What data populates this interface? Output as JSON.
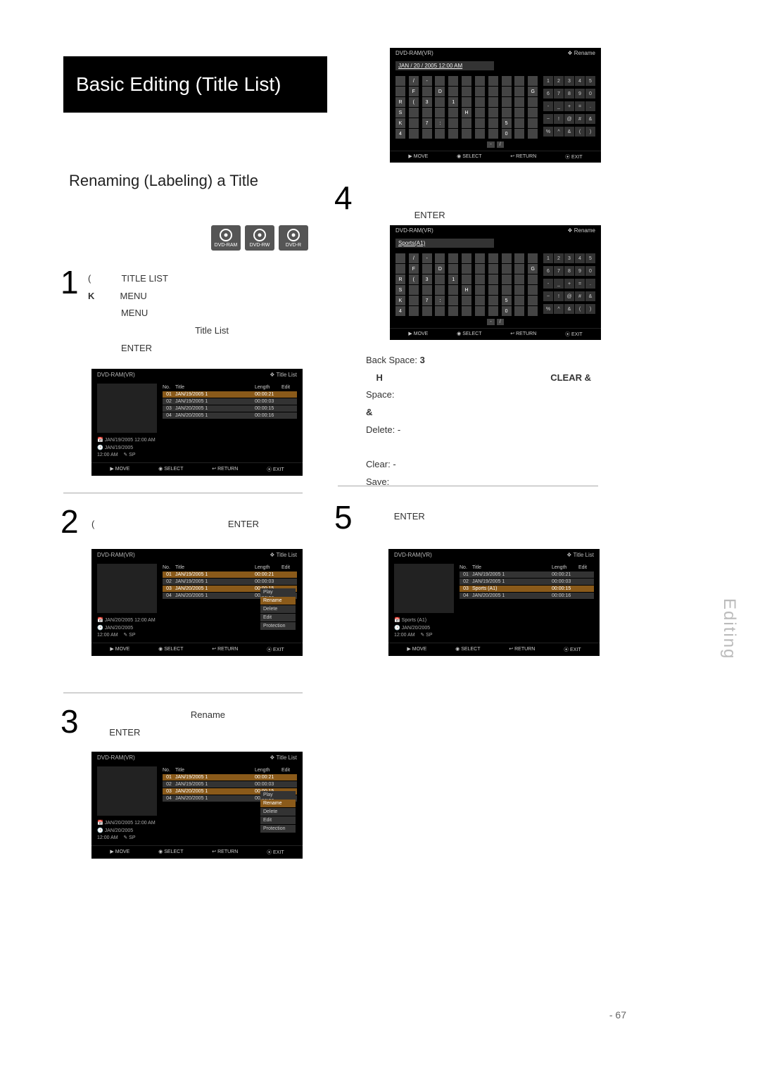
{
  "page": {
    "title": "Basic Editing (Title List)",
    "section": "Renaming (Labeling) a Title",
    "sideTab": "Editing",
    "pageNumber": "- 67"
  },
  "discs": [
    "DVD-RAM",
    "DVD-RW",
    "DVD-R"
  ],
  "steps": {
    "s1": {
      "num": "1",
      "paren": "(",
      "lines": [
        "TITLE LIST",
        "K        MENU",
        "MENU",
        "Title List",
        "ENTER"
      ]
    },
    "s2": {
      "num": "2",
      "paren": "(",
      "enter": "ENTER"
    },
    "s3": {
      "num": "3",
      "rename": "Rename",
      "enter": "ENTER"
    },
    "s4": {
      "num": "4",
      "enter": "ENTER"
    },
    "s5": {
      "num": "5",
      "enter": "ENTER"
    }
  },
  "keyDefs": {
    "backspace": {
      "label": "Back Space:",
      "val": "3"
    },
    "clearTrail": "CLEAR &",
    "h": "H",
    "space": {
      "label": "Space:",
      "val": ""
    },
    "amp": "&",
    "delete": {
      "label": "Delete:",
      "val": "-"
    },
    "clear": {
      "label": "Clear:",
      "val": "-"
    },
    "save": {
      "label": "Save:",
      "val": ""
    }
  },
  "ui": {
    "header_device": "DVD-RAM(VR)",
    "header_mode_title": "❖ Title List",
    "header_mode_rename": "❖ Rename",
    "thead": [
      "No.",
      "Title",
      "Length",
      "Edit"
    ],
    "rows1": [
      {
        "no": "01",
        "title": "JAN/19/2005 1",
        "len": "00:00:21",
        "edit": "",
        "sel": true
      },
      {
        "no": "02",
        "title": "JAN/19/2005 1",
        "len": "00:00:03",
        "edit": ""
      },
      {
        "no": "03",
        "title": "JAN/20/2005 1",
        "len": "00:00:15",
        "edit": ""
      },
      {
        "no": "04",
        "title": "JAN/20/2005 1",
        "len": "00:00:16",
        "edit": ""
      }
    ],
    "rows4": [
      {
        "no": "01",
        "title": "JAN/19/2005 1",
        "len": "00:00:21",
        "edit": ""
      },
      {
        "no": "02",
        "title": "JAN/19/2005 1",
        "len": "00:00:03",
        "edit": ""
      },
      {
        "no": "03",
        "title": "Sports (A1)",
        "len": "00:00:15",
        "edit": "",
        "sel": true
      },
      {
        "no": "04",
        "title": "JAN/20/2005 1",
        "len": "00:00:16",
        "edit": ""
      }
    ],
    "meta1": {
      "l1": "JAN/19/2005 12:00 AM",
      "l2": "JAN/19/2005",
      "l3": "12:00 AM",
      "sp": "✎ SP"
    },
    "meta2": {
      "l1": "JAN/20/2005 12:00 AM",
      "l2": "JAN/20/2005",
      "l3": "12:00 AM",
      "sp": "✎ SP"
    },
    "meta4": {
      "l1": "Sports (A1)",
      "l2": "JAN/20/2005",
      "l3": "12:00 AM",
      "sp": "✎ SP"
    },
    "menu": [
      {
        "label": "Play"
      },
      {
        "label": "Rename",
        "sel": true
      },
      {
        "label": "Delete"
      },
      {
        "label": "Edit"
      },
      {
        "label": "Protection"
      }
    ],
    "footer": [
      "MOVE",
      "SELECT",
      "RETURN",
      "EXIT"
    ]
  },
  "kb": {
    "input1": "JAN   /   20 / 2005   12:00   AM",
    "input2": "Sports(A1)",
    "letters": [
      "",
      "/",
      "-",
      "",
      "",
      "",
      "",
      "",
      "",
      "",
      "",
      "",
      "F",
      "",
      "D",
      "",
      "",
      "",
      "",
      "",
      "",
      "G",
      "R",
      "(",
      "3",
      "",
      "1",
      "",
      "",
      "",
      "",
      "",
      "",
      "S",
      "",
      "",
      "",
      "",
      "H",
      "",
      "",
      "",
      "",
      "",
      "K",
      "",
      "7",
      ":",
      "",
      "",
      "",
      "",
      "5",
      "",
      "",
      "4",
      "",
      "",
      "",
      "",
      "",
      "",
      "",
      "0",
      "",
      ""
    ],
    "nums": [
      "1",
      "2",
      "3",
      "4",
      "5",
      "6",
      "7",
      "8",
      "9",
      "0",
      "-",
      "_",
      "+",
      "=",
      ".",
      "~",
      "!",
      "@",
      "#",
      "&",
      "%",
      "^",
      "&",
      "(",
      ")"
    ],
    "bottom": [
      "-",
      "/"
    ],
    "footer": [
      "MOVE",
      "SELECT",
      "RETURN",
      "EXIT"
    ]
  }
}
